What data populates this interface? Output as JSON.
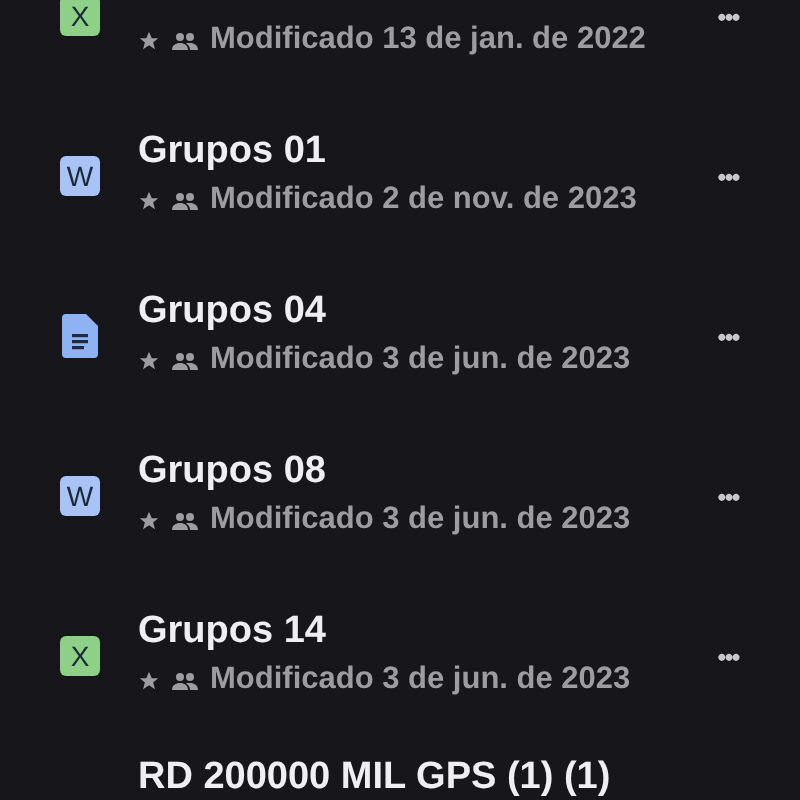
{
  "files": [
    {
      "kind": "sheet",
      "badge": "X",
      "meta": "Modificado 13 de jan. de 2022",
      "menu": "•••"
    },
    {
      "kind": "word",
      "badge": "W",
      "title": "Grupos 01",
      "meta": "Modificado 2 de nov. de 2023",
      "menu": "•••"
    },
    {
      "kind": "doc",
      "title": "Grupos 04",
      "meta": "Modificado 3 de jun. de 2023",
      "menu": "•••"
    },
    {
      "kind": "word",
      "badge": "W",
      "title": "Grupos 08",
      "meta": "Modificado 3 de jun. de 2023",
      "menu": "•••"
    },
    {
      "kind": "sheet",
      "badge": "X",
      "title": "Grupos 14",
      "meta": "Modificado 3 de jun. de 2023",
      "menu": "•••"
    },
    {
      "kind": "none",
      "title": "RD 200000 MIL GPS (1) (1)"
    }
  ]
}
